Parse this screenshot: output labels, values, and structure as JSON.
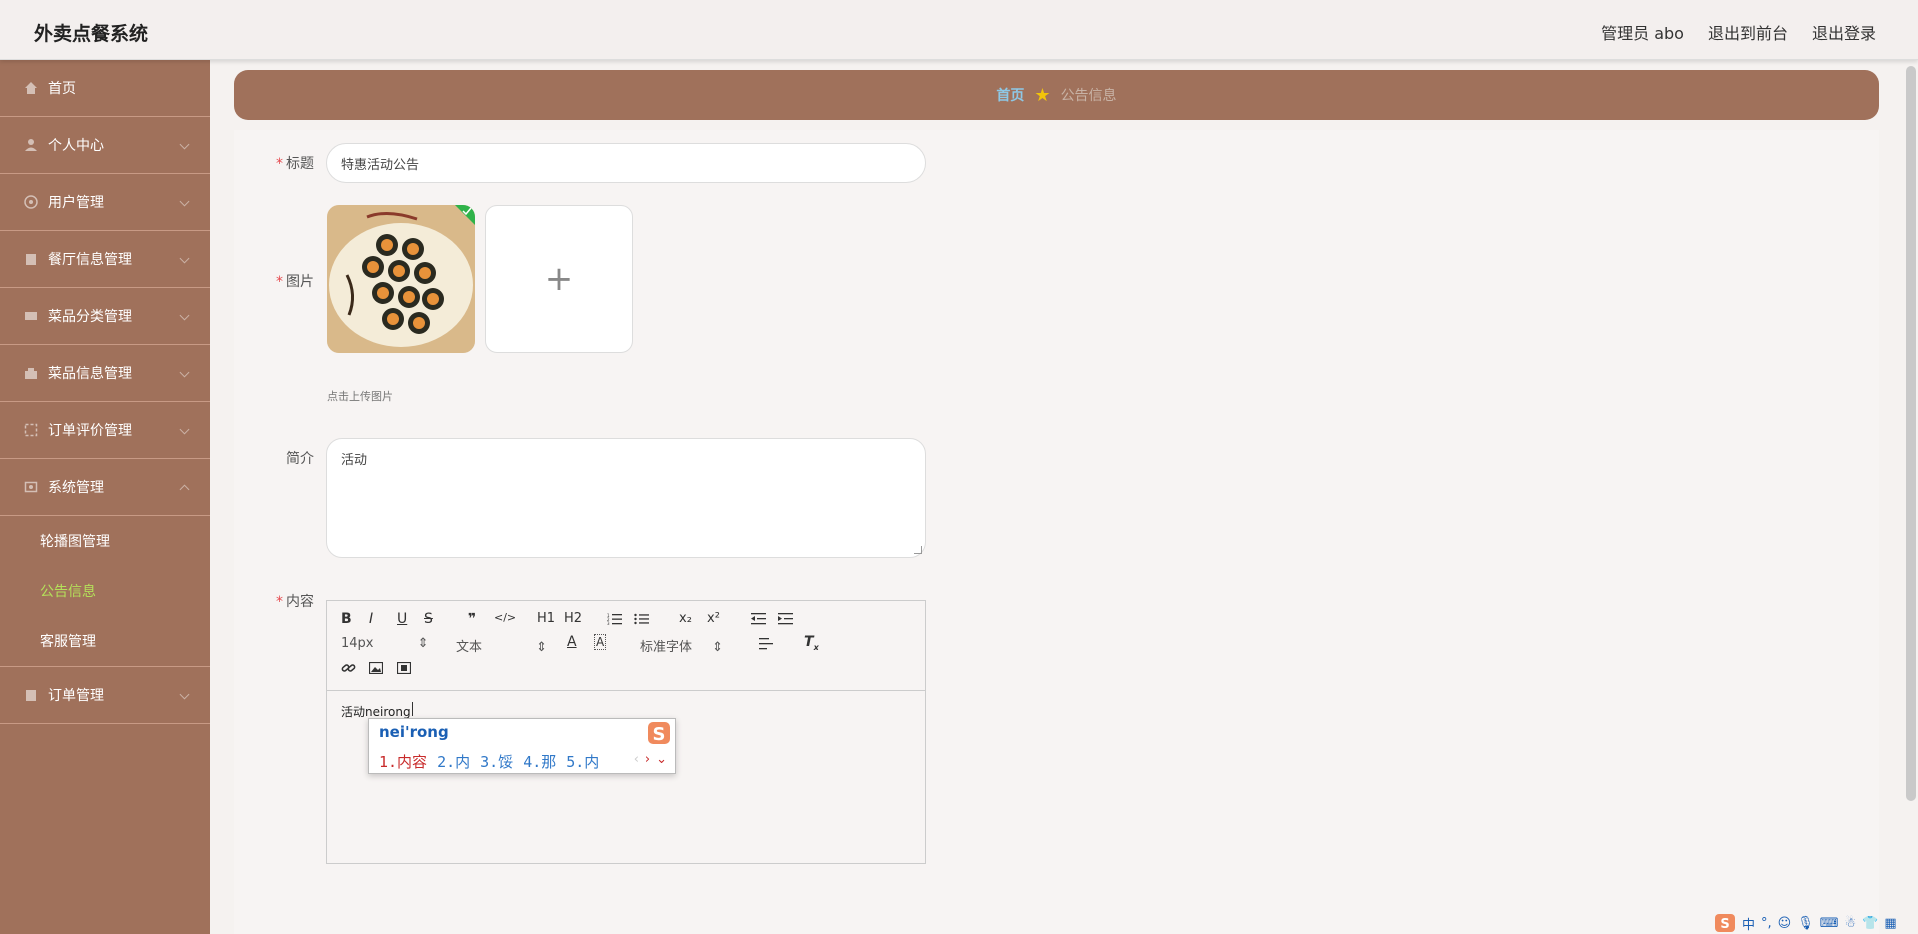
{
  "header": {
    "brand": "外卖点餐系统",
    "nav": [
      "管理员 abo",
      "退出到前台",
      "退出登录"
    ]
  },
  "sidebar": {
    "items": [
      {
        "label": "首页",
        "icon": "home-icon"
      },
      {
        "label": "个人中心",
        "icon": "user-icon"
      },
      {
        "label": "用户管理",
        "icon": "users-icon"
      },
      {
        "label": "餐厅信息管理",
        "icon": "restaurant-icon"
      },
      {
        "label": "菜品分类管理",
        "icon": "category-icon"
      },
      {
        "label": "菜品信息管理",
        "icon": "dish-icon"
      },
      {
        "label": "订单评价管理",
        "icon": "review-icon"
      },
      {
        "label": "系统管理",
        "icon": "system-icon"
      },
      {
        "label": "订单管理",
        "icon": "order-icon"
      }
    ],
    "submenu": [
      "轮播图管理",
      "公告信息",
      "客服管理"
    ],
    "active_sub": "公告信息"
  },
  "breadcrumb": {
    "home": "首页",
    "current": "公告信息"
  },
  "form": {
    "title_label": "标题",
    "title_value": "特惠活动公告",
    "image_label": "图片",
    "upload_plus": "+",
    "upload_hint": "点击上传图片",
    "intro_label": "简介",
    "intro_value": "活动",
    "content_label": "内容"
  },
  "editor": {
    "font_size": "14px",
    "format": "文本",
    "font_family": "标准字体",
    "buttons": [
      "B",
      "I",
      "U",
      "S",
      "❞",
      "</>",
      "H1",
      "H2",
      "ol",
      "ul",
      "x₂",
      "x²",
      "outdent",
      "indent"
    ],
    "content": "活动neirong"
  },
  "ime": {
    "pinyin": "nei'rong",
    "candidates": [
      "1.内容",
      "2.内",
      "3.馁",
      "4.那",
      "5.内"
    ]
  },
  "tray": {
    "lang": "中"
  },
  "colors": {
    "sidebar": "#a0715b",
    "active_sub": "#b4e05a",
    "breadcrumb_home": "#8ec8e6",
    "required": "#e5484d"
  }
}
